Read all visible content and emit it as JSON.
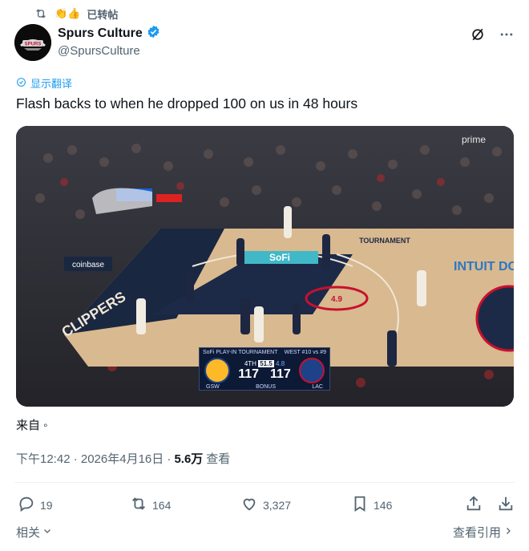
{
  "repost": {
    "emoji": "👏👍",
    "label": "已转帖"
  },
  "author": {
    "name": "Spurs Culture",
    "handle": "@SpursCulture",
    "avatar_text": "SPURS"
  },
  "translate_label": "显示翻译",
  "tweet_text": "Flash backs to when he dropped 100 on us in 48 hours",
  "media": {
    "broadcast_logo": "prime",
    "scoreboard": {
      "sponsor": "SoFi",
      "event": "PLAY-IN TOURNAMENT",
      "matchup": "WEST #10 vs #9",
      "quarter": "4TH",
      "clock": "51.5",
      "shot_clock": "4.8",
      "home_team": "GSW",
      "away_team": "LAC",
      "home_score": "117",
      "away_score": "117",
      "bonus": "BONUS"
    },
    "court_texts": {
      "sofi": "SoFi",
      "clippers": "CLIPPERS",
      "intuit": "INTUIT DOME",
      "tournament": "TOURNAMENT",
      "coinbase": "coinbase",
      "court_number": "4.9"
    }
  },
  "source_label": "来自 ◦",
  "timestamp": "下午12:42 · 2026年4月16日 · ",
  "views_count": "5.6万",
  "views_label": " 查看",
  "actions": {
    "replies": "19",
    "reposts": "164",
    "likes": "3,327",
    "bookmarks": "146"
  },
  "related_label": "相关",
  "view_quotes_label": "查看引用"
}
